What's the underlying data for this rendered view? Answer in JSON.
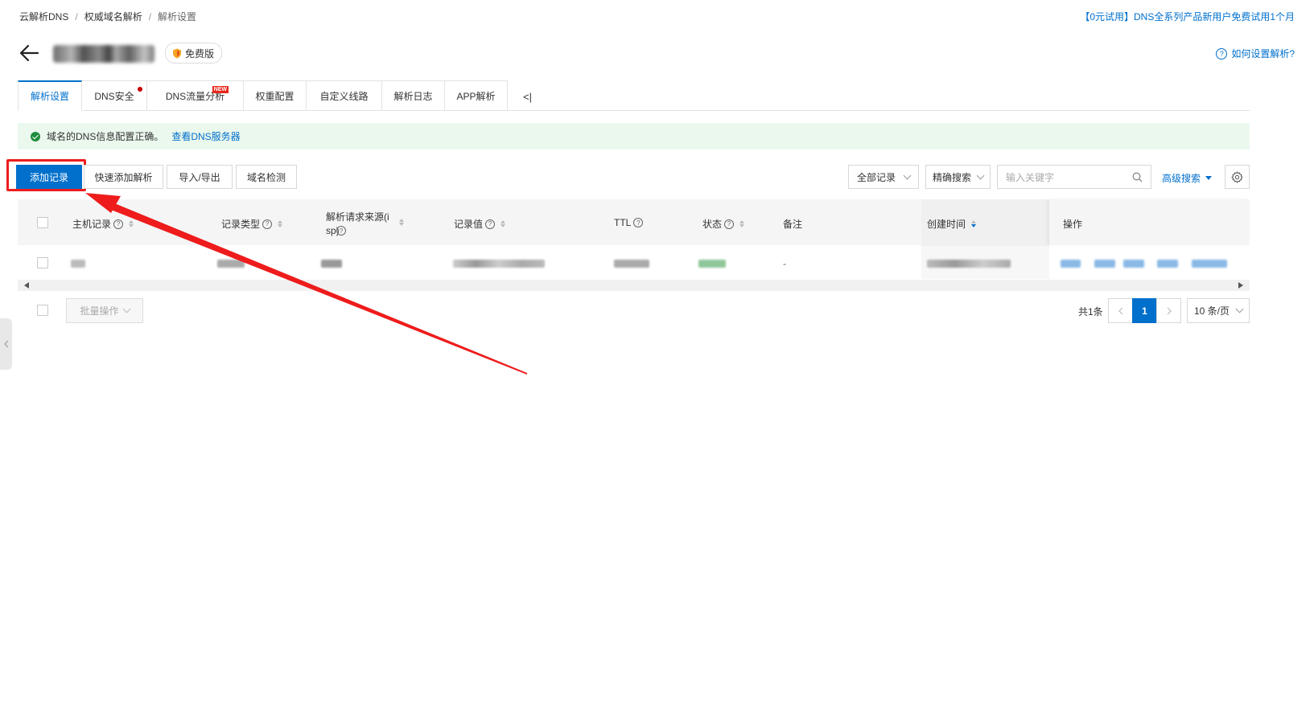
{
  "breadcrumb": [
    "云解析DNS",
    "权威域名解析",
    "解析设置"
  ],
  "breadcrumb_sep": "/",
  "promo": "【0元试用】DNS全系列产品新用户免费试用1个月",
  "header": {
    "edition_badge": "免费版",
    "help_link": "如何设置解析?"
  },
  "tabs": [
    {
      "label": "解析设置",
      "active": true
    },
    {
      "label": "DNS安全",
      "dot": true
    },
    {
      "label": "DNS流量分析",
      "new": "NEW"
    },
    {
      "label": "权重配置"
    },
    {
      "label": "自定义线路"
    },
    {
      "label": "解析日志"
    },
    {
      "label": "APP解析"
    }
  ],
  "collapse_tabs_glyph": "<|",
  "alert": {
    "message": "域名的DNS信息配置正确。",
    "link": "查看DNS服务器"
  },
  "toolbar": {
    "add_record": "添加记录",
    "quick_add": "快速添加解析",
    "import_export": "导入/导出",
    "domain_check": "域名检测",
    "record_filter": "全部记录",
    "search_mode": "精确搜索",
    "search_placeholder": "输入关键字",
    "advanced_search": "高级搜索"
  },
  "table": {
    "columns": [
      "主机记录",
      "记录类型",
      "解析请求来源(isp)",
      "记录值",
      "TTL",
      "状态",
      "备注",
      "创建时间",
      "操作"
    ],
    "row_remark": "-"
  },
  "footer": {
    "batch_action": "批量操作",
    "total": "共1条",
    "current_page": "1",
    "page_size": "10 条/页"
  },
  "colors": {
    "primary": "#0070cc",
    "annotation": "#ee1c1c",
    "success_bg": "#ebf8ee"
  }
}
